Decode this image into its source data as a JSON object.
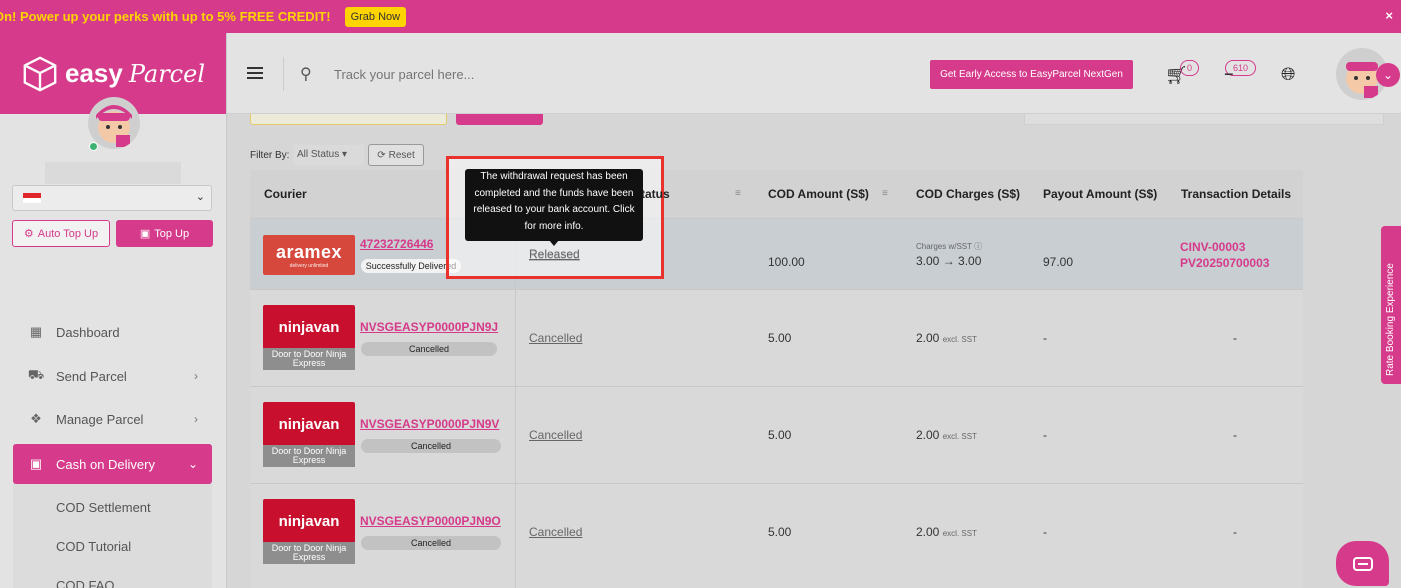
{
  "promo": {
    "text": "On! Power up your perks with up to 5% FREE CREDIT!",
    "button": "Grab Now",
    "close": "×"
  },
  "logo": {
    "brand": "easy",
    "script": "Parcel",
    "mark": "®"
  },
  "sidebar": {
    "auto_topup": "Auto Top Up",
    "topup": "Top Up",
    "nav": [
      {
        "label": "Dashboard",
        "icon": "dashboard-icon"
      },
      {
        "label": "Send Parcel",
        "icon": "truck-icon"
      },
      {
        "label": "Manage Parcel",
        "icon": "boxes-icon"
      },
      {
        "label": "Cash on Delivery",
        "icon": "cash-icon"
      }
    ],
    "sub": [
      "COD Settlement",
      "COD Tutorial",
      "COD FAQ"
    ]
  },
  "header": {
    "search_placeholder": "Track your parcel here...",
    "nextgen": "Get Early Access to EasyParcel NextGen",
    "cart_count": "0",
    "notif_count": "610"
  },
  "filter": {
    "label": "Filter By:",
    "value": "All Status ▾",
    "reset": "Reset"
  },
  "table": {
    "headers": [
      "Courier",
      "Status",
      "COD Amount (S$)",
      "COD Charges (S$)",
      "Payout Amount (S$)",
      "Transaction Details"
    ],
    "rows": [
      {
        "courier": "aramex",
        "courier_tag": "delivery unlimited",
        "tracking": "47232726446",
        "status": "Successfully Delivered",
        "payout_status": "Released",
        "cod_amount": "100.00",
        "charges_note": "Charges w/SST ⓘ",
        "charges": "3.00 → 3.00",
        "charges_suffix": "",
        "payout": "97.00",
        "txn1": "CINV-00003",
        "txn2": "PV20250700003"
      },
      {
        "courier": "ninjavan",
        "service": "Door to Door Ninja Express",
        "tracking": "NVSGEASYP0000PJN9J",
        "status": "Cancelled",
        "payout_status": "Cancelled",
        "cod_amount": "5.00",
        "charges": "2.00",
        "charges_suffix": "excl. SST",
        "payout": "-",
        "txn1": "-"
      },
      {
        "courier": "ninjavan",
        "service": "Door to Door Ninja Express",
        "tracking": "NVSGEASYP0000PJN9V",
        "status": "Cancelled",
        "payout_status": "Cancelled",
        "cod_amount": "5.00",
        "charges": "2.00",
        "charges_suffix": "excl. SST",
        "payout": "-",
        "txn1": "-"
      },
      {
        "courier": "ninjavan",
        "service": "Door to Door Ninja Express",
        "tracking": "NVSGEASYP0000PJN9O",
        "status": "Cancelled",
        "payout_status": "Cancelled",
        "cod_amount": "5.00",
        "charges": "2.00",
        "charges_suffix": "excl. SST",
        "payout": "-",
        "txn1": "-"
      }
    ]
  },
  "tooltip": {
    "text": "The withdrawal request has been completed and the funds have been released to your bank account. Click for more info."
  },
  "side_tab": "Rate Booking Experience",
  "colors": {
    "brand": "#d63a8a",
    "promo_text": "#ffd400",
    "highlight": "#e8322b"
  }
}
